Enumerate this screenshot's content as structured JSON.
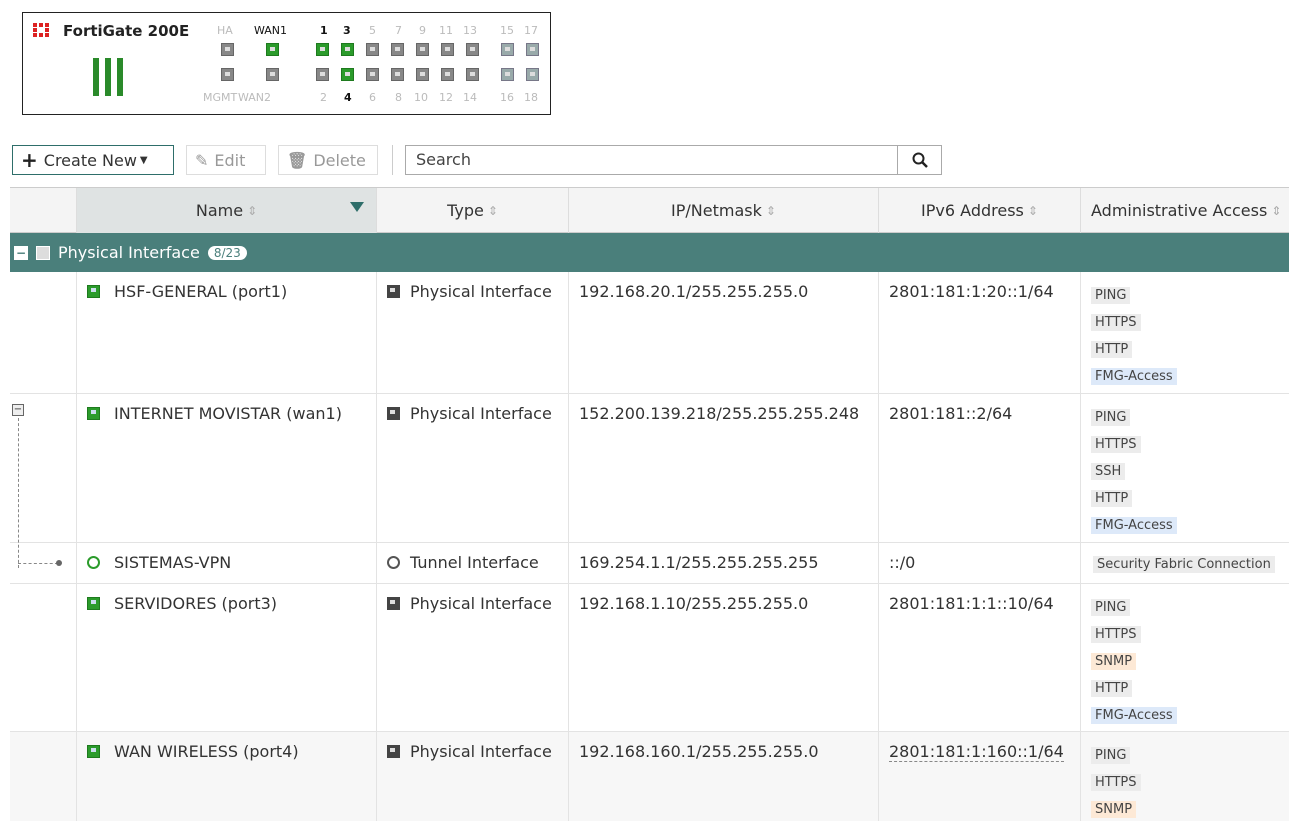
{
  "device": {
    "title": "FortiGate 200E",
    "top_labels": [
      "HA",
      "WAN1",
      "1",
      "3",
      "5",
      "7",
      "9",
      "11",
      "13",
      "15",
      "17"
    ],
    "bottom_labels": [
      "MGMT",
      "WAN2",
      "2",
      "4",
      "6",
      "8",
      "10",
      "12",
      "14",
      "16",
      "18"
    ]
  },
  "toolbar": {
    "create_new": "Create New",
    "edit": "Edit",
    "delete": "Delete",
    "search_placeholder": "Search"
  },
  "table": {
    "headers": {
      "name": "Name",
      "type": "Type",
      "ip": "IP/Netmask",
      "ipv6": "IPv6 Address",
      "admin": "Administrative Access"
    },
    "group": {
      "label": "Physical Interface",
      "count": "8/23"
    },
    "rows": [
      {
        "name": "HSF-GENERAL (port1)",
        "type": "Physical Interface",
        "ip": "192.168.20.1/255.255.255.0",
        "ipv6": "2801:181:1:20::1/64",
        "access": [
          "PING",
          "HTTPS",
          "HTTP",
          "FMG-Access"
        ]
      },
      {
        "name": "INTERNET MOVISTAR (wan1)",
        "type": "Physical Interface",
        "ip": "152.200.139.218/255.255.255.248",
        "ipv6": "2801:181::2/64",
        "access": [
          "PING",
          "HTTPS",
          "SSH",
          "HTTP",
          "FMG-Access"
        ]
      },
      {
        "name": "SISTEMAS-VPN",
        "type": "Tunnel Interface",
        "ip": "169.254.1.1/255.255.255.255",
        "ipv6": "::/0",
        "access": [
          "Security Fabric Connection"
        ]
      },
      {
        "name": "SERVIDORES (port3)",
        "type": "Physical Interface",
        "ip": "192.168.1.10/255.255.255.0",
        "ipv6": "2801:181:1:1::10/64",
        "access": [
          "PING",
          "HTTPS",
          "SNMP",
          "HTTP",
          "FMG-Access"
        ]
      },
      {
        "name": "WAN WIRELESS (port4)",
        "type": "Physical Interface",
        "ip": "192.168.160.1/255.255.255.0",
        "ipv6": "2801:181:1:160::1/64",
        "access": [
          "PING",
          "HTTPS",
          "SNMP"
        ]
      }
    ]
  },
  "colors": {
    "accent": "#4a7f7b",
    "port_up": "#2b9b2b",
    "fmg_tag": "#dde9f9",
    "snmp_tag": "#fde9d6"
  }
}
